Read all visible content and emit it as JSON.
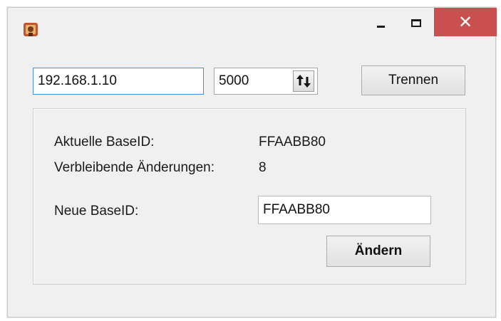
{
  "window": {
    "title": "",
    "controls": {
      "minimize_icon": "minimize-icon",
      "maximize_icon": "maximize-icon",
      "close_icon": "close-icon",
      "close_glyph": "✕"
    },
    "colors": {
      "close_bg": "#c9504e",
      "accent": "#4a8fd6"
    }
  },
  "connection": {
    "ip_value": "192.168.1.10",
    "port_value": "5000",
    "disconnect_label": "Trennen"
  },
  "base_id": {
    "current_label": "Aktuelle BaseID:",
    "current_value": "FFAABB80",
    "remaining_label": "Verbleibende Änderungen:",
    "remaining_value": "8",
    "new_label": "Neue BaseID:",
    "new_value": "FFAABB80",
    "change_label": "Ändern"
  }
}
